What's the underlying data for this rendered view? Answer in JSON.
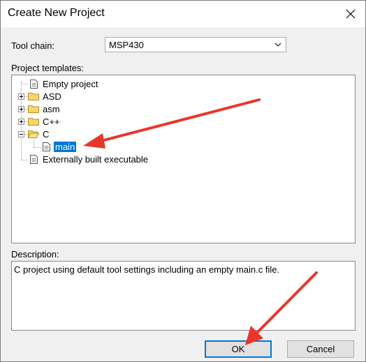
{
  "dialog": {
    "title": "Create New Project",
    "close_icon": "close-icon"
  },
  "toolchain": {
    "label": "Tool chain:",
    "value": "MSP430"
  },
  "templates": {
    "label": "Project templates:",
    "items": [
      {
        "label": "Empty project",
        "icon": "file-icon"
      },
      {
        "label": "ASD",
        "icon": "folder-icon",
        "expander": "plus"
      },
      {
        "label": "asm",
        "icon": "folder-icon",
        "expander": "plus"
      },
      {
        "label": "C++",
        "icon": "folder-icon",
        "expander": "plus"
      },
      {
        "label": "C",
        "icon": "folder-icon",
        "expander": "minus"
      },
      {
        "label": "main",
        "icon": "file-icon",
        "selected": true
      },
      {
        "label": "Externally built executable",
        "icon": "file-icon"
      }
    ]
  },
  "description": {
    "label": "Description:",
    "text": "C project using default tool settings including an empty main.c file."
  },
  "buttons": {
    "ok": "OK",
    "cancel": "Cancel"
  },
  "colors": {
    "selection": "#0078d7",
    "annotation_arrow": "#e8362a"
  }
}
